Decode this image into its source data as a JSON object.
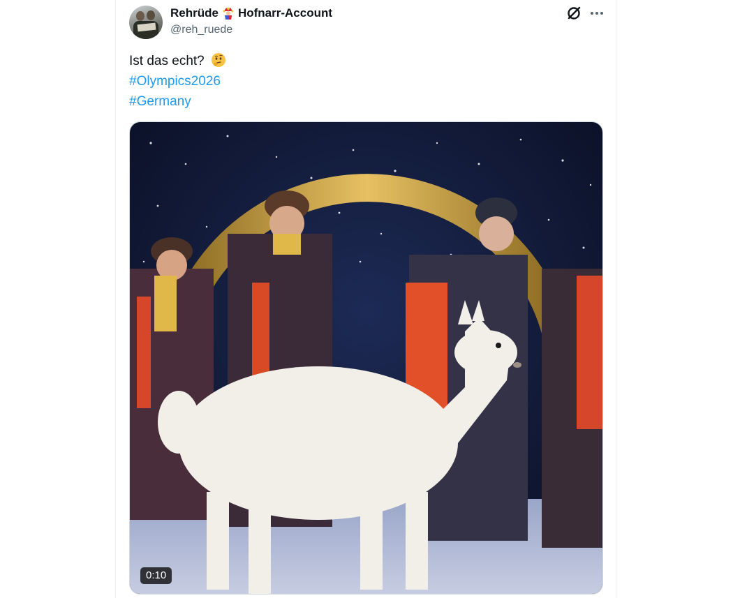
{
  "tweet": {
    "display_name": "Rehrüde",
    "account_suffix": "Hofnarr-Account",
    "badge_icon": "jester-icon",
    "handle": "@reh_ruede",
    "text_line1": "Ist das echt?",
    "text_emoji": "thinking-face-emoji",
    "hashtags": [
      "#Olympics2026",
      "#Germany"
    ],
    "video": {
      "duration": "0:10"
    }
  },
  "colors": {
    "hashtag": "#1d9bf0",
    "text": "#0f1419",
    "secondary": "#536471"
  }
}
